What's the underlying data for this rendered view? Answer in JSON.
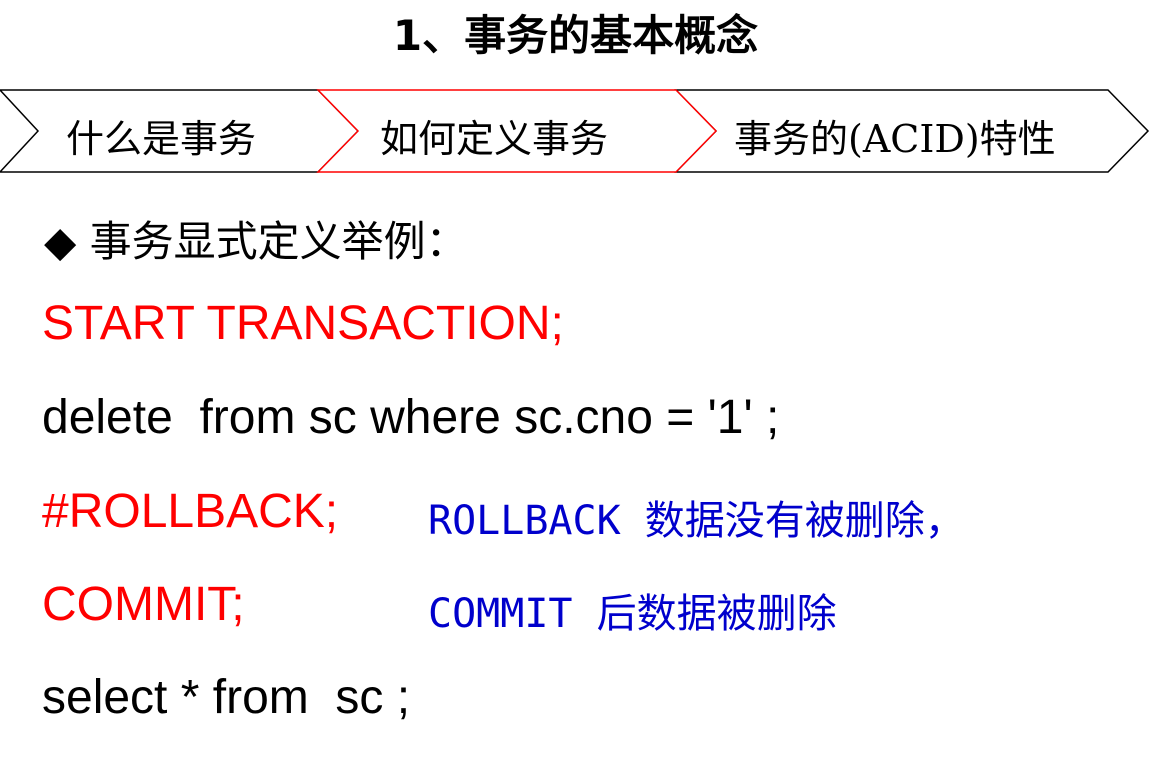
{
  "title": "1、事务的基本概念",
  "tabs": [
    {
      "label": "什么是事务"
    },
    {
      "label": "如何定义事务",
      "active": true
    },
    {
      "label": "事务的(ACID)特性"
    }
  ],
  "colors": {
    "active_tab_border": "#ff0000",
    "code_keyword": "#ff0000",
    "comment": "#0000cc"
  },
  "bullet": {
    "icon": "diamond-bullet-icon",
    "symbol": "◆",
    "text": "事务显式定义举例："
  },
  "code": [
    {
      "text": "START TRANSACTION;",
      "color": "red"
    },
    {
      "text": "delete  from sc where sc.cno = '1' ;",
      "color": "black"
    },
    {
      "text": "#ROLLBACK;",
      "color": "red",
      "note": "ROLLBACK 数据没有被删除，"
    },
    {
      "text": "COMMIT;",
      "color": "red",
      "note": "COMMIT 后数据被删除"
    },
    {
      "text": "select * from  sc ;",
      "color": "black"
    }
  ]
}
